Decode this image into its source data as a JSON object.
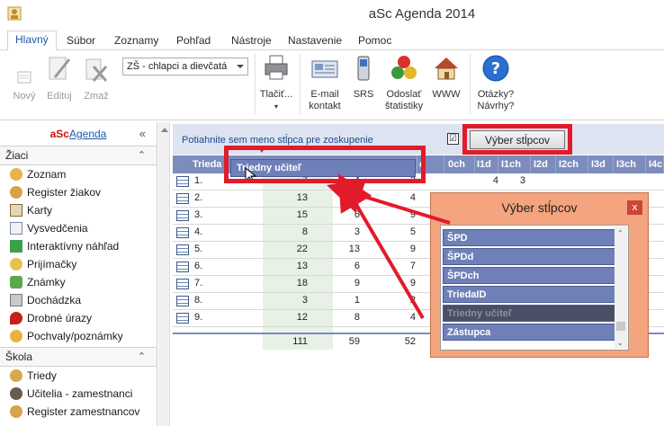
{
  "window": {
    "title": "aSc Agenda 2014"
  },
  "tabs": [
    "Hlavný",
    "Súbor",
    "Zoznamy",
    "Pohľad",
    "Nástroje",
    "Nastavenie",
    "Pomoc"
  ],
  "ribbon": {
    "new": "Nový",
    "edit": "Edituj",
    "delete": "Zmaž",
    "filter_value": "ZŠ - chlapci a dievčatá",
    "print": "Tlačiť...",
    "email_line1": "E-mail",
    "email_line2": "kontakt",
    "srs": "SRS",
    "stats_line1": "Odoslať",
    "stats_line2": "štatistiky",
    "www": "WWW",
    "help_line1": "Otázky?",
    "help_line2": "Návrhy?"
  },
  "sidebar": {
    "brand_a": "aSc",
    "brand_b": "Agenda",
    "collapse": "«",
    "sections": [
      {
        "title": "Žiaci",
        "items": [
          "Zoznam",
          "Register žiakov",
          "Karty",
          "Vysvedčenia",
          "Interaktívny náhľad",
          "Prijímačky",
          "Známky",
          "Dochádzka",
          "Drobné úrazy",
          "Pochvaly/poznámky"
        ]
      },
      {
        "title": "Škola",
        "items": [
          "Triedy",
          "Učitelia - zamestnanci",
          "Register zamestnancov"
        ]
      }
    ]
  },
  "grid": {
    "group_hint": "Potiahnite sem meno stĺpca pre zoskupenie",
    "checkbox_mark": "☑",
    "choose_columns_button": "Výber stĺpcov",
    "headers": [
      "Trieda",
      "d",
      "0ch",
      "I1d",
      "I1ch",
      "I2d",
      "I2ch",
      "I3d",
      "I3ch",
      "I4c"
    ],
    "rows": [
      {
        "trieda": "1.",
        "a": "7",
        "b": "4",
        "c": "3",
        "d": "4",
        "e": "3"
      },
      {
        "trieda": "2.",
        "a": "13",
        "b": "9",
        "c": "4",
        "d": "",
        "e": ""
      },
      {
        "trieda": "3.",
        "a": "15",
        "b": "6",
        "c": "9",
        "d": "",
        "e": ""
      },
      {
        "trieda": "4.",
        "a": "8",
        "b": "3",
        "c": "5",
        "d": "",
        "e": ""
      },
      {
        "trieda": "5.",
        "a": "22",
        "b": "13",
        "c": "9",
        "d": "",
        "e": ""
      },
      {
        "trieda": "6.",
        "a": "13",
        "b": "6",
        "c": "7",
        "d": "",
        "e": ""
      },
      {
        "trieda": "7.",
        "a": "18",
        "b": "9",
        "c": "9",
        "d": "",
        "e": ""
      },
      {
        "trieda": "8.",
        "a": "3",
        "b": "1",
        "c": "2",
        "d": "",
        "e": ""
      },
      {
        "trieda": "9.",
        "a": "12",
        "b": "8",
        "c": "4",
        "d": "",
        "e": ""
      }
    ],
    "totals": {
      "a": "111",
      "b": "59",
      "c": "52"
    },
    "drag_ghost": "Triedny učiteľ"
  },
  "popup": {
    "title": "Výber stĺpcov",
    "close": "x",
    "items": [
      "ŠPD",
      "ŠPDd",
      "ŠPDch",
      "TriedaID",
      "Triedny učiteľ",
      "Zástupca"
    ],
    "selected_index": 4
  },
  "colors": {
    "highlight": "#e11b2a",
    "header": "#7c8cbd",
    "popup_bg": "#f4a47e"
  }
}
